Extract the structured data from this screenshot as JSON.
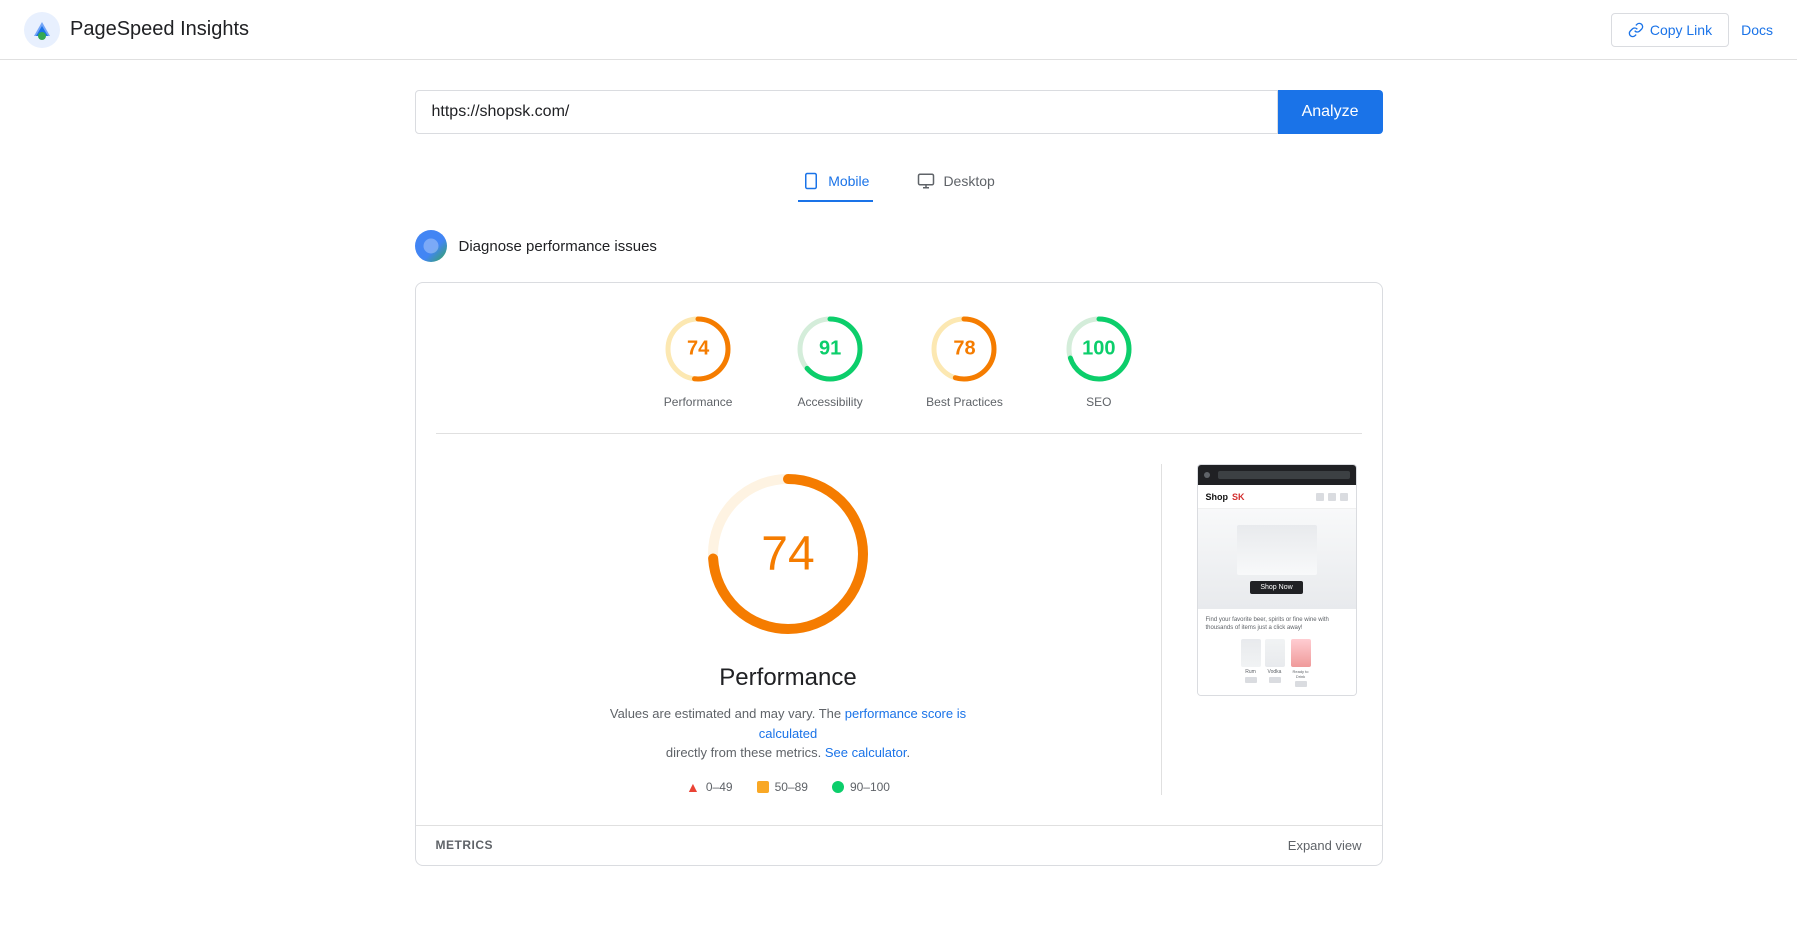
{
  "header": {
    "app_title": "PageSpeed Insights",
    "copy_link_label": "Copy Link",
    "docs_label": "Docs"
  },
  "search": {
    "url_value": "https://shopsk.com/",
    "analyze_label": "Analyze"
  },
  "tabs": [
    {
      "id": "mobile",
      "label": "Mobile",
      "active": true
    },
    {
      "id": "desktop",
      "label": "Desktop",
      "active": false
    }
  ],
  "diagnose": {
    "text": "Diagnose performance issues"
  },
  "scores": [
    {
      "id": "performance",
      "value": 74,
      "label": "Performance",
      "color": "#f57c00",
      "track_color": "#fce8b2",
      "score_pct": 74
    },
    {
      "id": "accessibility",
      "value": 91,
      "label": "Accessibility",
      "color": "#0cce6b",
      "track_color": "#d4edda",
      "score_pct": 91
    },
    {
      "id": "best-practices",
      "value": 78,
      "label": "Best Practices",
      "color": "#f57c00",
      "track_color": "#fce8b2",
      "score_pct": 78
    },
    {
      "id": "seo",
      "value": 100,
      "label": "SEO",
      "color": "#0cce6b",
      "track_color": "#d4edda",
      "score_pct": 100
    }
  ],
  "performance_detail": {
    "score": 74,
    "title": "Performance",
    "description_prefix": "Values are estimated and may vary. The",
    "link1_text": "performance score is calculated",
    "description_middle": "directly from these metrics.",
    "link2_text": "See calculator",
    "description_suffix": "."
  },
  "legend": [
    {
      "id": "red",
      "range": "0–49",
      "type": "triangle"
    },
    {
      "id": "orange",
      "range": "50–89",
      "type": "square"
    },
    {
      "id": "green",
      "range": "90–100",
      "type": "circle"
    }
  ],
  "bottom": {
    "metrics_label": "METRICS",
    "expand_label": "Expand view"
  },
  "screenshot": {
    "products": [
      {
        "name": "Rum"
      },
      {
        "name": "Vodka"
      },
      {
        "name": "Ready to Drink"
      }
    ],
    "cta_text": "Shop Now",
    "tagline": "Find your favorite beer, spirits or fine wine with thousands of items just a click away!"
  }
}
